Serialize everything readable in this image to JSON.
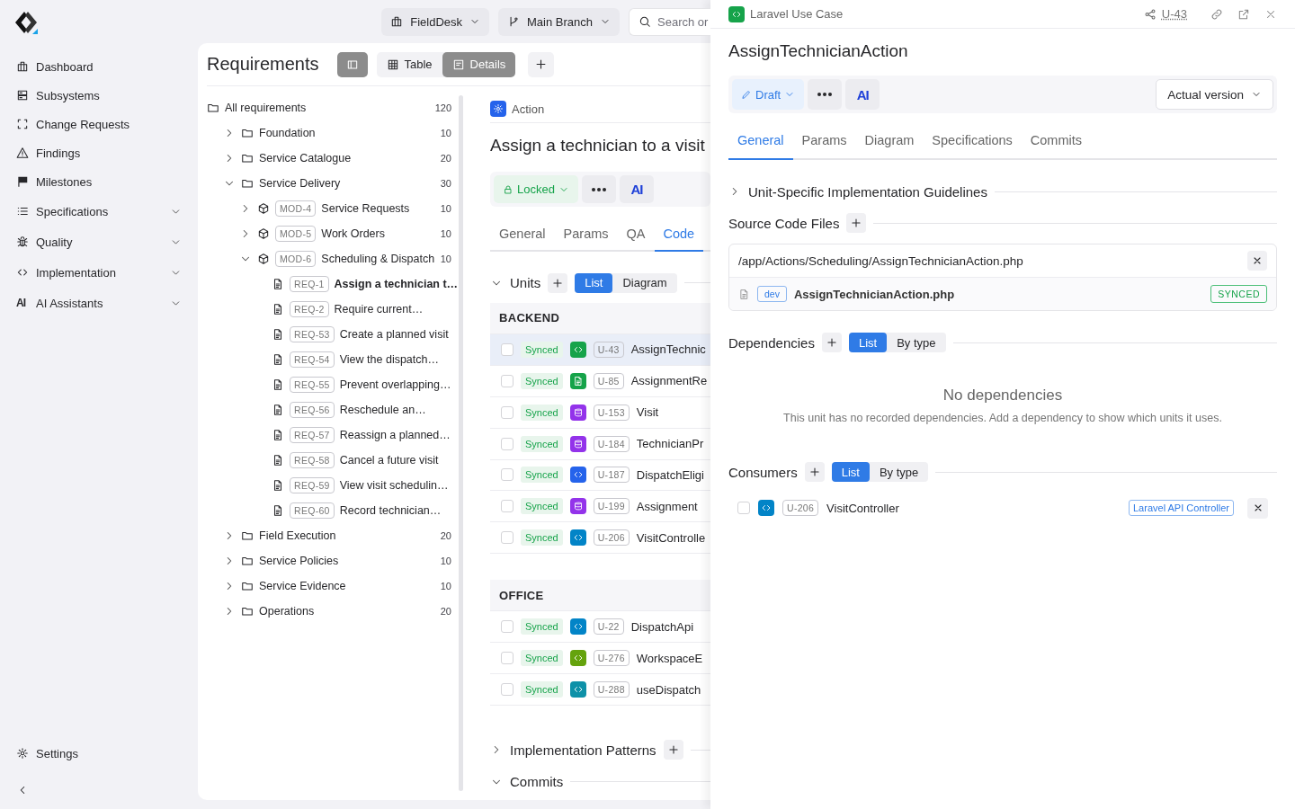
{
  "sidebar": {
    "items": [
      {
        "label": "Dashboard",
        "kind": "link"
      },
      {
        "label": "Subsystems",
        "kind": "link"
      },
      {
        "label": "Change Requests",
        "kind": "link"
      },
      {
        "label": "Findings",
        "kind": "link"
      },
      {
        "label": "Milestones",
        "kind": "link"
      },
      {
        "label": "Specifications",
        "kind": "group",
        "expanded": false
      },
      {
        "label": "Quality",
        "kind": "group",
        "expanded": false
      },
      {
        "label": "Implementation",
        "kind": "group",
        "expanded": false
      },
      {
        "label": "AI Assistants",
        "kind": "group",
        "expanded": false,
        "icon_text": "AI"
      }
    ],
    "footer": {
      "label": "Settings"
    }
  },
  "topbar": {
    "workspace": "FieldDesk",
    "branch": "Main Branch",
    "search": {
      "placeholder": "Search or"
    }
  },
  "requirements": {
    "title": "Requirements",
    "panel_toggle_on": true,
    "views": [
      {
        "label": "Table",
        "selected": false
      },
      {
        "label": "Details",
        "selected": true
      }
    ],
    "tree": {
      "kind": "root",
      "label": "All requirements",
      "count": "120",
      "children": [
        {
          "kind": "folder",
          "label": "Foundation",
          "count": "10",
          "expanded": false
        },
        {
          "kind": "folder",
          "label": "Service Catalogue",
          "count": "20",
          "expanded": false
        },
        {
          "kind": "folder",
          "label": "Service Delivery",
          "count": "30",
          "expanded": true,
          "children": [
            {
              "kind": "module",
              "tag": "MOD-4",
              "label": "Service Requests",
              "count": "10",
              "expanded": false
            },
            {
              "kind": "module",
              "tag": "MOD-5",
              "label": "Work Orders",
              "count": "10",
              "expanded": false
            },
            {
              "kind": "module",
              "tag": "MOD-6",
              "label": "Scheduling & Dispatch",
              "count": "10",
              "expanded": true,
              "children": [
                {
                  "kind": "requirement",
                  "tag": "REQ-1",
                  "label": "Assign a technician t…",
                  "selected": true
                },
                {
                  "kind": "requirement",
                  "tag": "REQ-2",
                  "label": "Require current…",
                  "selected": false
                },
                {
                  "kind": "requirement",
                  "tag": "REQ-53",
                  "label": "Create a planned visit",
                  "selected": false
                },
                {
                  "kind": "requirement",
                  "tag": "REQ-54",
                  "label": "View the dispatch…",
                  "selected": false
                },
                {
                  "kind": "requirement",
                  "tag": "REQ-55",
                  "label": "Prevent overlapping…",
                  "selected": false
                },
                {
                  "kind": "requirement",
                  "tag": "REQ-56",
                  "label": "Reschedule an…",
                  "selected": false
                },
                {
                  "kind": "requirement",
                  "tag": "REQ-57",
                  "label": "Reassign a planned…",
                  "selected": false
                },
                {
                  "kind": "requirement",
                  "tag": "REQ-58",
                  "label": "Cancel a future visit",
                  "selected": false
                },
                {
                  "kind": "requirement",
                  "tag": "REQ-59",
                  "label": "View visit schedulin…",
                  "selected": false
                },
                {
                  "kind": "requirement",
                  "tag": "REQ-60",
                  "label": "Record technician…",
                  "selected": false
                }
              ]
            }
          ]
        },
        {
          "kind": "folder",
          "label": "Field Execution",
          "count": "20",
          "expanded": false
        },
        {
          "kind": "folder",
          "label": "Service Policies",
          "count": "10",
          "expanded": false
        },
        {
          "kind": "folder",
          "label": "Service Evidence",
          "count": "10",
          "expanded": false
        },
        {
          "kind": "folder",
          "label": "Operations",
          "count": "20",
          "expanded": false
        }
      ]
    }
  },
  "detail": {
    "type": "Action",
    "title": "Assign a technician to a visit",
    "status": {
      "label": "Locked",
      "kind": "locked"
    },
    "ai": "AI",
    "tabs": [
      {
        "label": "General",
        "selected": false
      },
      {
        "label": "Params",
        "selected": false
      },
      {
        "label": "QA",
        "selected": false
      },
      {
        "label": "Code",
        "selected": true
      }
    ],
    "units": {
      "title": "Units",
      "expanded": true,
      "views": [
        {
          "label": "List",
          "selected": true
        },
        {
          "label": "Diagram",
          "selected": false
        }
      ],
      "groups": [
        {
          "name": "BACKEND",
          "rows": [
            {
              "checked": false,
              "status": "Synced",
              "kind": "code",
              "color": "#16a34a",
              "tag": "U-43",
              "name": "AssignTechnic",
              "selected": true
            },
            {
              "checked": false,
              "status": "Synced",
              "kind": "doc",
              "color": "#16a34a",
              "tag": "U-85",
              "name": "AssignmentRe",
              "selected": false
            },
            {
              "checked": false,
              "status": "Synced",
              "kind": "db",
              "color": "#9333ea",
              "tag": "U-153",
              "name": "Visit",
              "selected": false
            },
            {
              "checked": false,
              "status": "Synced",
              "kind": "db",
              "color": "#9333ea",
              "tag": "U-184",
              "name": "TechnicianPr",
              "selected": false
            },
            {
              "checked": false,
              "status": "Synced",
              "kind": "code",
              "color": "#2563eb",
              "tag": "U-187",
              "name": "DispatchEligi",
              "selected": false
            },
            {
              "checked": false,
              "status": "Synced",
              "kind": "db",
              "color": "#9333ea",
              "tag": "U-199",
              "name": "Assignment",
              "selected": false
            },
            {
              "checked": false,
              "status": "Synced",
              "kind": "code",
              "color": "#0284c7",
              "tag": "U-206",
              "name": "VisitControlle",
              "selected": false
            }
          ]
        },
        {
          "name": "OFFICE",
          "rows": [
            {
              "checked": false,
              "status": "Synced",
              "kind": "code",
              "color": "#0284c7",
              "tag": "U-22",
              "name": "DispatchApi",
              "selected": false
            },
            {
              "checked": false,
              "status": "Synced",
              "kind": "code",
              "color": "#65a30d",
              "tag": "U-276",
              "name": "WorkspaceE",
              "selected": false
            },
            {
              "checked": false,
              "status": "Synced",
              "kind": "code",
              "color": "#0e91a8",
              "tag": "U-288",
              "name": "useDispatch",
              "selected": false
            }
          ]
        }
      ]
    },
    "sections": [
      {
        "title": "Implementation Patterns",
        "expanded": false,
        "addable": true
      },
      {
        "title": "Commits",
        "expanded": true,
        "addable": false
      }
    ]
  },
  "drawer": {
    "type": "Laravel Use Case",
    "type_badge": {
      "kind": "code",
      "color": "#16a34a"
    },
    "id": "U-43",
    "title": "AssignTechnicianAction",
    "status": {
      "label": "Draft",
      "kind": "draft"
    },
    "ai": "AI",
    "version": "Actual version",
    "tabs": [
      {
        "label": "General",
        "selected": true
      },
      {
        "label": "Params",
        "selected": false
      },
      {
        "label": "Diagram",
        "selected": false
      },
      {
        "label": "Specifications",
        "selected": false
      },
      {
        "label": "Commits",
        "selected": false
      }
    ],
    "guidelines": {
      "title": "Unit-Specific Implementation Guidelines",
      "expanded": false
    },
    "source_files": {
      "title": "Source Code Files",
      "files": [
        {
          "path": "/app/Actions/Scheduling/AssignTechnicianAction.php",
          "branch": "dev",
          "name": "AssignTechnicianAction.php",
          "status": "SYNCED"
        }
      ]
    },
    "dependencies": {
      "title": "Dependencies",
      "views": [
        {
          "label": "List",
          "selected": true
        },
        {
          "label": "By type",
          "selected": false
        }
      ],
      "empty_title": "No dependencies",
      "empty_text": "This unit has no recorded dependencies. Add a dependency to show which units it uses."
    },
    "consumers": {
      "title": "Consumers",
      "views": [
        {
          "label": "List",
          "selected": true
        },
        {
          "label": "By type",
          "selected": false
        }
      ],
      "rows": [
        {
          "checked": false,
          "kind": "code",
          "color": "#0284c7",
          "tag": "U-206",
          "name": "VisitController",
          "type": "Laravel API Controller"
        }
      ]
    }
  }
}
